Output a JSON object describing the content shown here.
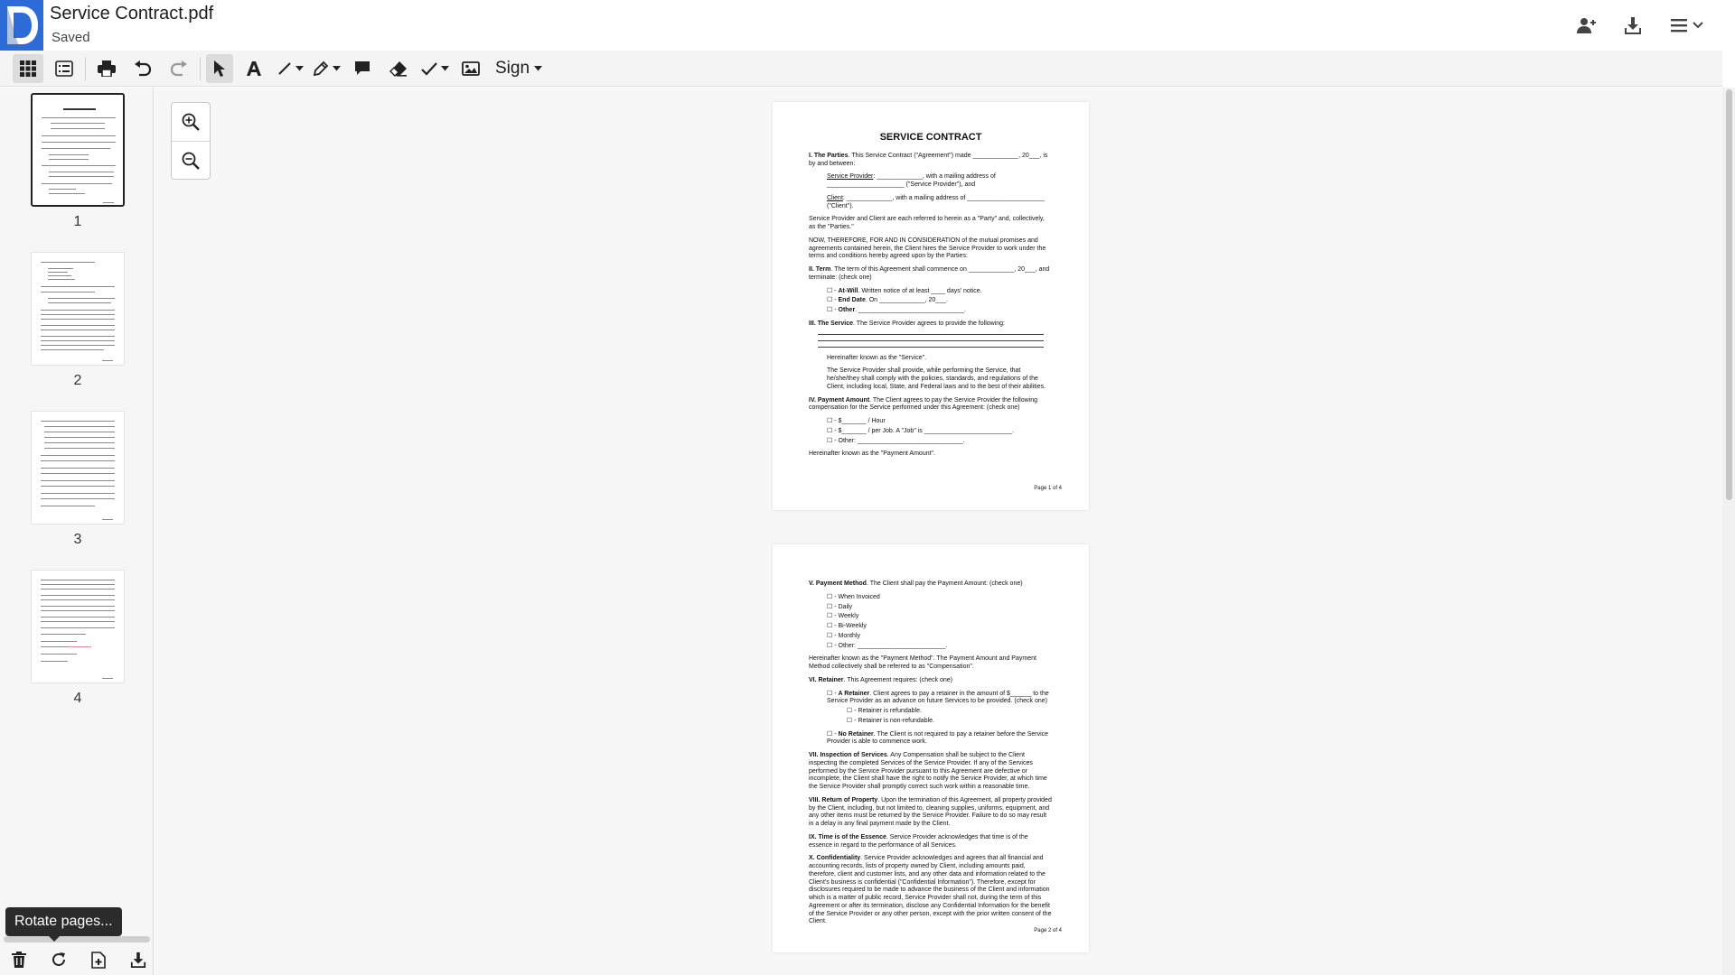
{
  "header": {
    "file_title": "Service Contract.pdf",
    "save_status": "Saved",
    "icons": [
      "add-user-icon",
      "download-icon",
      "menu-icon",
      "chevron-down-icon"
    ]
  },
  "toolbar": {
    "sign_label": "Sign",
    "icons": [
      "grid-view-icon",
      "list-view-icon",
      "print-icon",
      "undo-icon",
      "redo-icon",
      "pointer-icon",
      "text-icon",
      "line-icon",
      "pen-icon",
      "comment-icon",
      "eraser-icon",
      "checkmark-icon",
      "image-icon"
    ]
  },
  "sidebar": {
    "pages": [
      {
        "number": "1",
        "selected": true
      },
      {
        "number": "2",
        "selected": false
      },
      {
        "number": "3",
        "selected": false
      },
      {
        "number": "4",
        "selected": false
      }
    ],
    "footer_icons": [
      "trash-icon",
      "rotate-icon",
      "add-page-icon",
      "download-icon"
    ],
    "tooltip": "Rotate pages..."
  },
  "viewer": {
    "zoom_icons": [
      "zoom-in-icon",
      "zoom-out-icon"
    ],
    "page1": {
      "title": "SERVICE CONTRACT",
      "p_parties_head": "I. The Parties",
      "p_parties": ". This Service Contract (\"Agreement\") made _____________, 20___, is by and between:",
      "sp_label": "Service Provider",
      "sp_text": ": _____________, with a mailing address of ______________________ (\"Service Provider\"), and",
      "client_label": "Client",
      "client_text": ": _____________, with a mailing address of ______________________ (\"Client\").",
      "p_party": "Service Provider and Client are each referred to herein as a \"Party\" and, collectively, as the \"Parties.\"",
      "p_now": "NOW, THEREFORE, FOR AND IN CONSIDERATION of the mutual promises and agreements contained herein, the Client hires the Service Provider to work under the terms and conditions hereby agreed upon by the Parties:",
      "term_head": "II. Term",
      "term_text": ". The term of this Agreement shall commence on _____________, 20___, and terminate: (check one)",
      "term_opts": [
        {
          "bold": "At-Will",
          "text": ". Written notice of at least ____ days' notice."
        },
        {
          "bold": "End Date",
          "text": ". On _____________, 20___."
        },
        {
          "bold": "Other",
          "text": ". ______________________________."
        }
      ],
      "service_head": "III. The Service",
      "service_text": ". The Service Provider agrees to provide the following:",
      "p_known_service": "Hereinafter known as the \"Service\".",
      "p_comply": "The Service Provider shall provide, while performing the Service, that he/she/they shall comply with the policies, standards, and regulations of the Client, including local, State, and Federal laws and to the best of their abilities.",
      "pay_head": "IV. Payment Amount",
      "pay_text": ". The Client agrees to pay the Service Provider the following compensation for the Service performed under this Agreement: (check one)",
      "pay_opts": [
        "☐ - $_______ / Hour",
        "☐ - $_______ / per Job. A \"Job\" is _________________________.",
        "☐ - Other: ______________________________."
      ],
      "p_known_payment": "Hereinafter known as the \"Payment Amount\".",
      "footer": "Page 1 of 4"
    },
    "page2": {
      "method_head": "V. Payment Method",
      "method_text": ". The Client shall pay the Payment Amount: (check one)",
      "method_opts": [
        "☐ - When Invoiced",
        "☐ - Daily",
        "☐ - Weekly",
        "☐ - Bi-Weekly",
        "☐ - Monthly",
        "☐ - Other: _________________________."
      ],
      "p_method_known": "Hereinafter known as the \"Payment Method\". The Payment Amount and Payment Method collectively shall be referred to as \"Compensation\".",
      "retainer_head": "VI. Retainer",
      "retainer_text": ". This Agreement requires: (check one)",
      "ret_a_bold": "A Retainer",
      "ret_a_text": ". Client agrees to pay a retainer in the amount of $______ to the Service Provider as an advance on future Services to be provided. (check one)",
      "ret_sub": [
        "☐ - Retainer is refundable.",
        "☐ - Retainer is non-refundable."
      ],
      "ret_no_bold": "No Retainer",
      "ret_no_text": ". The Client is not required to pay a retainer before the Service Provider is able to commence work.",
      "insp_head": "VII. Inspection of Services",
      "insp_text": ". Any Compensation shall be subject to the Client inspecting the completed Services of the Service Provider. If any of the Services performed by the Service Provider pursuant to this Agreement are defective or incomplete, the Client shall have the right to notify the Service Provider, at which time the Service Provider shall promptly correct such work within a reasonable time.",
      "return_head": "VIII. Return of Property",
      "return_text": ". Upon the termination of this Agreement, all property provided by the Client, including, but not limited to, cleaning supplies, uniforms, equipment, and any other items must be returned by the Service Provider. Failure to do so may result in a delay in any final payment made by the Client.",
      "time_head": "IX. Time is of the Essence",
      "time_text": ". Service Provider acknowledges that time is of the essence in regard to the performance of all Services.",
      "conf_head": "X. Confidentiality",
      "conf_text": ". Service Provider acknowledges and agrees that all financial and accounting records, lists of property owned by Client, including amounts paid, therefore, client and customer lists, and any other data and information related to the Client's business is confidential (\"Confidential Information\"). Therefore, except for disclosures required to be made to advance the business of the Client and information which is a matter of public record, Service Provider shall not, during the term of this Agreement or after its termination, disclose any Confidential Information for the benefit of the Service Provider or any other person, except with the prior written consent of the Client.",
      "footer": "Page 2 of 4"
    }
  }
}
